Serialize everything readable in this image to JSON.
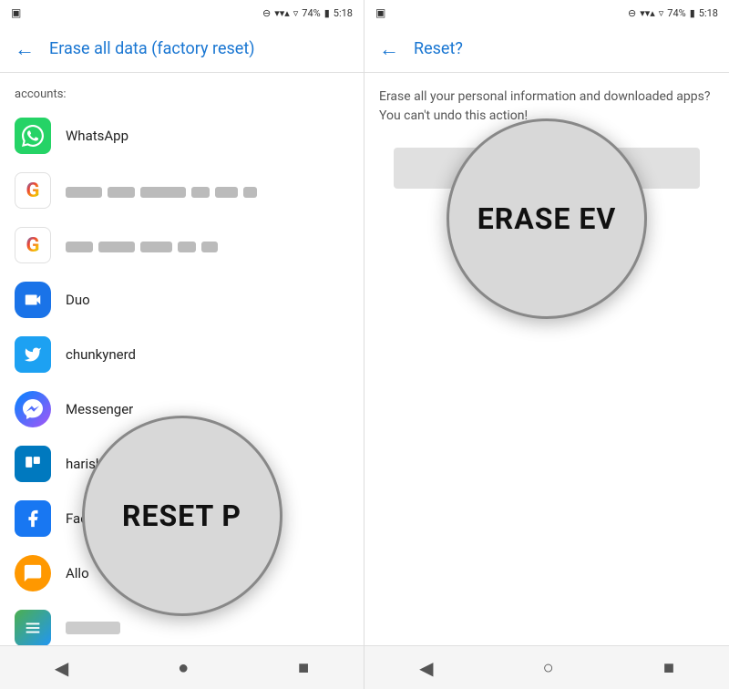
{
  "left_panel": {
    "status_bar": {
      "battery": "74%",
      "time": "5:18"
    },
    "title": "Erase all data (factory reset)",
    "section_label": "accounts:",
    "apps": [
      {
        "name": "WhatsApp",
        "icon_type": "whatsapp"
      },
      {
        "name": "google_account_1",
        "icon_type": "google",
        "blurred": true
      },
      {
        "name": "google_account_2",
        "icon_type": "google",
        "blurred": true
      },
      {
        "name": "Duo",
        "icon_type": "duo"
      },
      {
        "name": "chunkynerd",
        "icon_type": "twitter"
      },
      {
        "name": "Messenger",
        "icon_type": "messenger"
      },
      {
        "name": "harishj",
        "icon_type": "trello"
      },
      {
        "name": "Facebook",
        "icon_type": "facebook"
      },
      {
        "name": "Allo",
        "icon_type": "allo"
      },
      {
        "name": "generic_app",
        "icon_type": "generic",
        "blurred": false
      }
    ],
    "magnify_text": "RESET P",
    "nav": [
      "◀",
      "●",
      "■"
    ]
  },
  "right_panel": {
    "status_bar": {
      "battery": "74%",
      "time": "5:18"
    },
    "title": "Reset?",
    "description": "Erase all your personal information and downloaded apps? You can't undo this action!",
    "erase_button_label": "ERASE EVERYTHING",
    "magnify_text": "ERASE EV",
    "nav": [
      "◀",
      "○",
      "■"
    ]
  }
}
